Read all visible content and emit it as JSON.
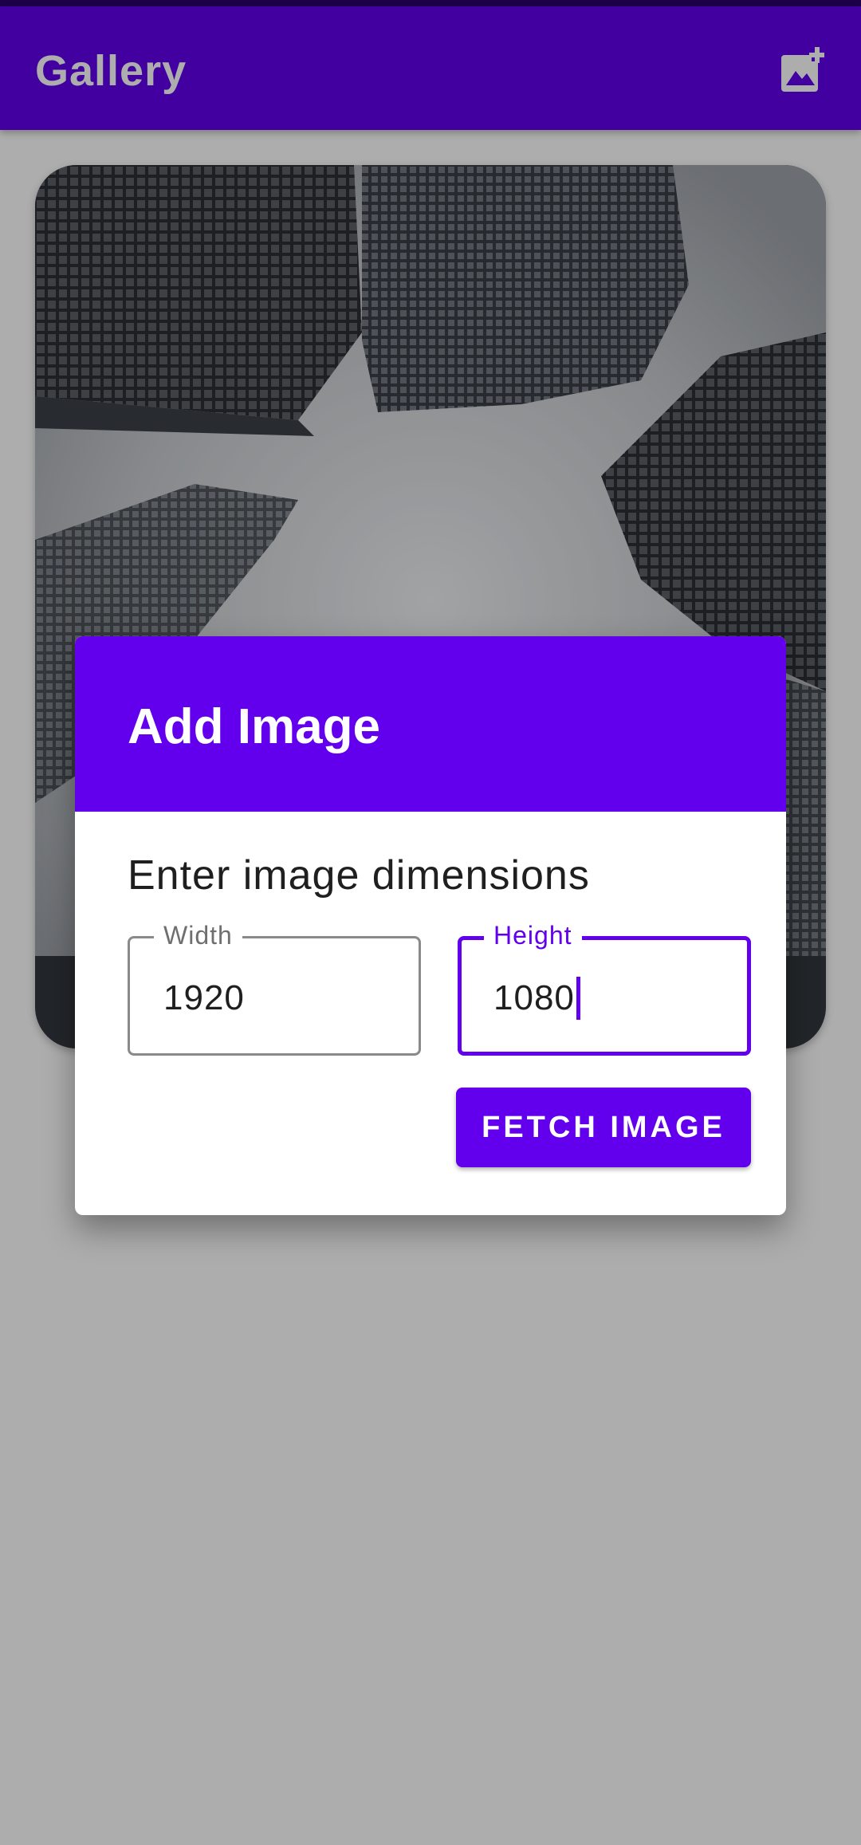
{
  "app_bar": {
    "title": "Gallery",
    "action_icon": "add-photo-icon",
    "background": "#6200ee"
  },
  "gallery": {
    "cards": [
      {
        "image": "skyscrapers-looking-up-photo"
      }
    ]
  },
  "dialog": {
    "title": "Add Image",
    "subtitle": "Enter image dimensions",
    "width_field": {
      "label": "Width",
      "value": "1920"
    },
    "height_field": {
      "label": "Height",
      "value": "1080",
      "focused": true
    },
    "fetch_button_label": "FETCH IMAGE",
    "accent": "#6200ee"
  }
}
